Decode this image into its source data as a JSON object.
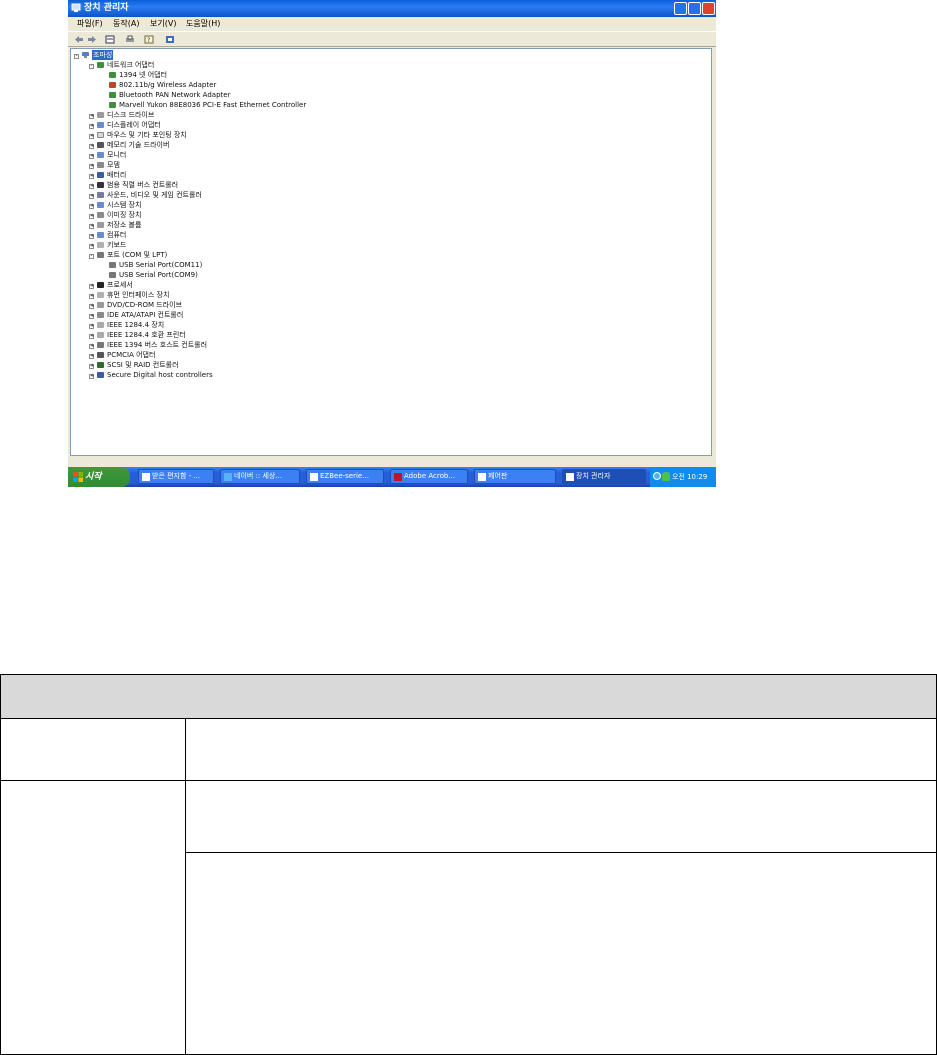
{
  "window": {
    "title": "장치 관리자",
    "menu": [
      "파일(F)",
      "동작(A)",
      "보기(V)",
      "도움말(H)"
    ]
  },
  "tree": {
    "root": "조마성",
    "network": "네트워크 어댑터",
    "network_children": [
      "1394 넷 어댑터",
      "802.11b/g Wireless Adapter",
      "Bluetooth PAN Network Adapter",
      "Marvell Yukon 88E8036 PCI-E Fast Ethernet Controller"
    ],
    "mid_items": [
      "디스크 드라이브",
      "디스플레이 어댑터",
      "마우스 및 기타 포인팅 장치",
      "메모리 기술 드라이버",
      "모니터",
      "모뎀",
      "배터리",
      "범용 직렬 버스 컨트롤러",
      "사운드, 비디오 및 게임 컨트롤러",
      "시스템 장치",
      "이미징 장치",
      "저장소 볼륨",
      "컴퓨터",
      "키보드"
    ],
    "ports": "포트 (COM 및 LPT)",
    "port_children": [
      "USB Serial Port(COM11)",
      "USB Serial Port(COM9)"
    ],
    "end_items": [
      "프로세서",
      "휴먼 인터페이스 장치",
      "DVD/CD-ROM 드라이브",
      "IDE ATA/ATAPI 컨트롤러",
      "IEEE 1284.4 장치",
      "IEEE 1284.4 호환 프린터",
      "IEEE 1394 버스 호스트 컨트롤러",
      "PCMCIA 어댑터",
      "SCSI 및 RAID 컨트롤러",
      "Secure Digital host controllers"
    ]
  },
  "taskbar": {
    "start": "시작",
    "tasks": [
      "받은 편지함 - ...",
      "네이버 :: 세상...",
      "EZBee-serie...",
      "Adobe Acrob...",
      "제어판",
      "장치 관리자"
    ],
    "clock": "오전 10:29"
  },
  "colors": {
    "titlebar": "#0a5fd8",
    "selection": "#316ac5",
    "taskbar": "#245edb",
    "start_button": "#3c9a3c",
    "table_header": "#d9d9d9"
  }
}
